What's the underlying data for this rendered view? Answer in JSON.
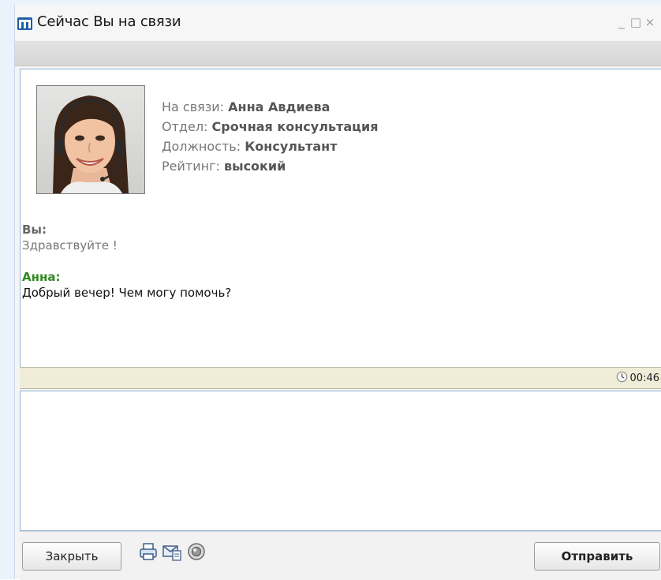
{
  "window": {
    "title": "Сейчас Вы на связи",
    "controls": {
      "minimize": "_",
      "maximize": "□",
      "close": "×"
    },
    "logo_icon": "m-logo",
    "accent": "#1e5fa6"
  },
  "operator": {
    "online_label": "На связи:",
    "online_value": "Анна Авдиева",
    "department_label": "Отдел:",
    "department_value": "Срочная консультация",
    "position_label": "Должность:",
    "position_value": "Консультант",
    "rating_label": "Рейтинг:",
    "rating_value": "высокий",
    "avatar_icon": "operator-photo"
  },
  "messages": [
    {
      "author": "Вы:",
      "text": "Здравствуйте !",
      "author_color": "#666666",
      "text_color": "#777777"
    },
    {
      "author": "Анна:",
      "text": "Добрый вечер! Чем могу помочь?",
      "author_color": "#2f8a1f",
      "text_color": "#111111"
    }
  ],
  "status": {
    "timer": "00:46",
    "timer_icon": "clock-icon"
  },
  "input": {
    "value": ""
  },
  "toolbar": {
    "close_label": "Закрыть",
    "send_label": "Отправить",
    "tools": [
      "print-icon",
      "email-icon",
      "sound-icon"
    ]
  }
}
